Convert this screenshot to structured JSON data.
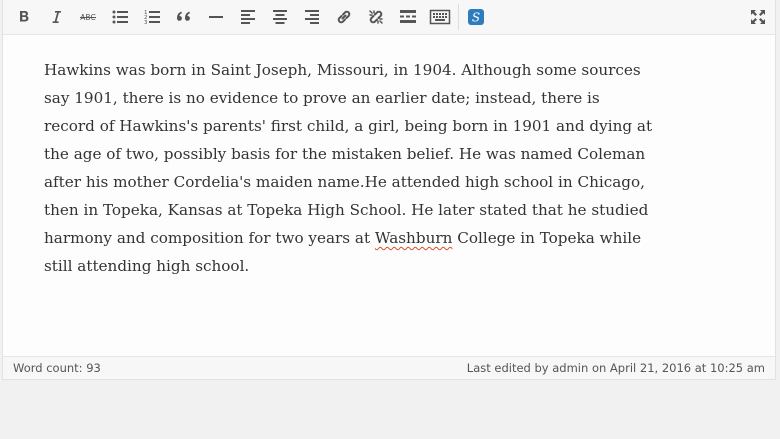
{
  "toolbar": {
    "buttons": [
      {
        "name": "bold",
        "icon": "bold-icon"
      },
      {
        "name": "italic",
        "icon": "italic-icon"
      },
      {
        "name": "strikethrough",
        "icon": "strikethrough-icon",
        "label": "ABC"
      },
      {
        "name": "bulleted-list",
        "icon": "bulleted-list-icon"
      },
      {
        "name": "numbered-list",
        "icon": "numbered-list-icon"
      },
      {
        "name": "blockquote",
        "icon": "blockquote-icon"
      },
      {
        "name": "horizontal-line",
        "icon": "horizontal-line-icon"
      },
      {
        "name": "align-left",
        "icon": "align-left-icon"
      },
      {
        "name": "align-center",
        "icon": "align-center-icon"
      },
      {
        "name": "align-right",
        "icon": "align-right-icon"
      },
      {
        "name": "insert-link",
        "icon": "link-icon"
      },
      {
        "name": "remove-link",
        "icon": "unlink-icon"
      },
      {
        "name": "read-more",
        "icon": "read-more-icon"
      },
      {
        "name": "toolbar-toggle",
        "icon": "keyboard-icon"
      },
      {
        "name": "spellcheck",
        "icon": "spellcheck-icon",
        "label": "S"
      },
      {
        "name": "fullscreen",
        "icon": "fullscreen-icon"
      }
    ],
    "accent_color": "#2e7cc0"
  },
  "content": {
    "before_misspelled": "Hawkins was born in Saint Joseph, Missouri, in 1904. Although some sources say 1901, there is no evidence to prove an earlier date; instead, there is record of Hawkins's parents' first child, a girl, being born in 1901 and dying at the age of two, possibly basis for the mistaken belief. He was named Coleman after his mother Cordelia's maiden name.He attended high school in Chicago, then in Topeka, Kansas at Topeka High School. He later stated that he studied harmony and composition for two years at ",
    "misspelled_word": "Washburn",
    "after_misspelled": " College in Topeka while still attending high school.",
    "spellcheck_underline_color": "#d54e21"
  },
  "status": {
    "word_count": "Word count: 93",
    "last_edited": "Last edited by admin on April 21, 2016 at 10:25 am"
  }
}
